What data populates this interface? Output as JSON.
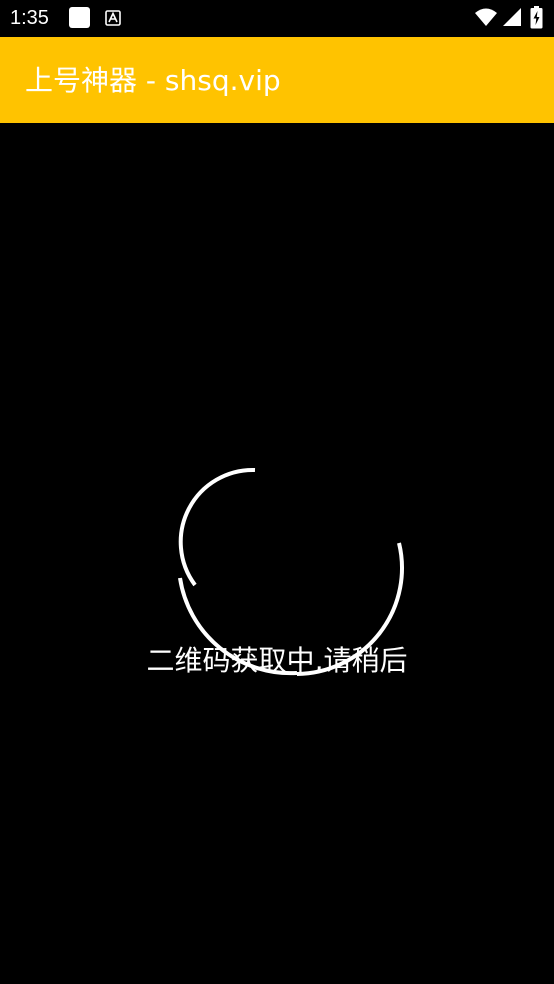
{
  "status_bar": {
    "time": "1:35",
    "notification_icons": [
      "square-app-icon",
      "a-letter-icon"
    ],
    "system_icons": [
      "wifi-icon",
      "cell-signal-icon",
      "battery-charging-icon"
    ]
  },
  "app_bar": {
    "title": "上号神器 - shsq.vip",
    "background_color": "#ffc300"
  },
  "main": {
    "loading_text": "二维码获取中,请稍后",
    "spinner_icon": "loading-spinner-icon",
    "background_color": "#000000"
  }
}
